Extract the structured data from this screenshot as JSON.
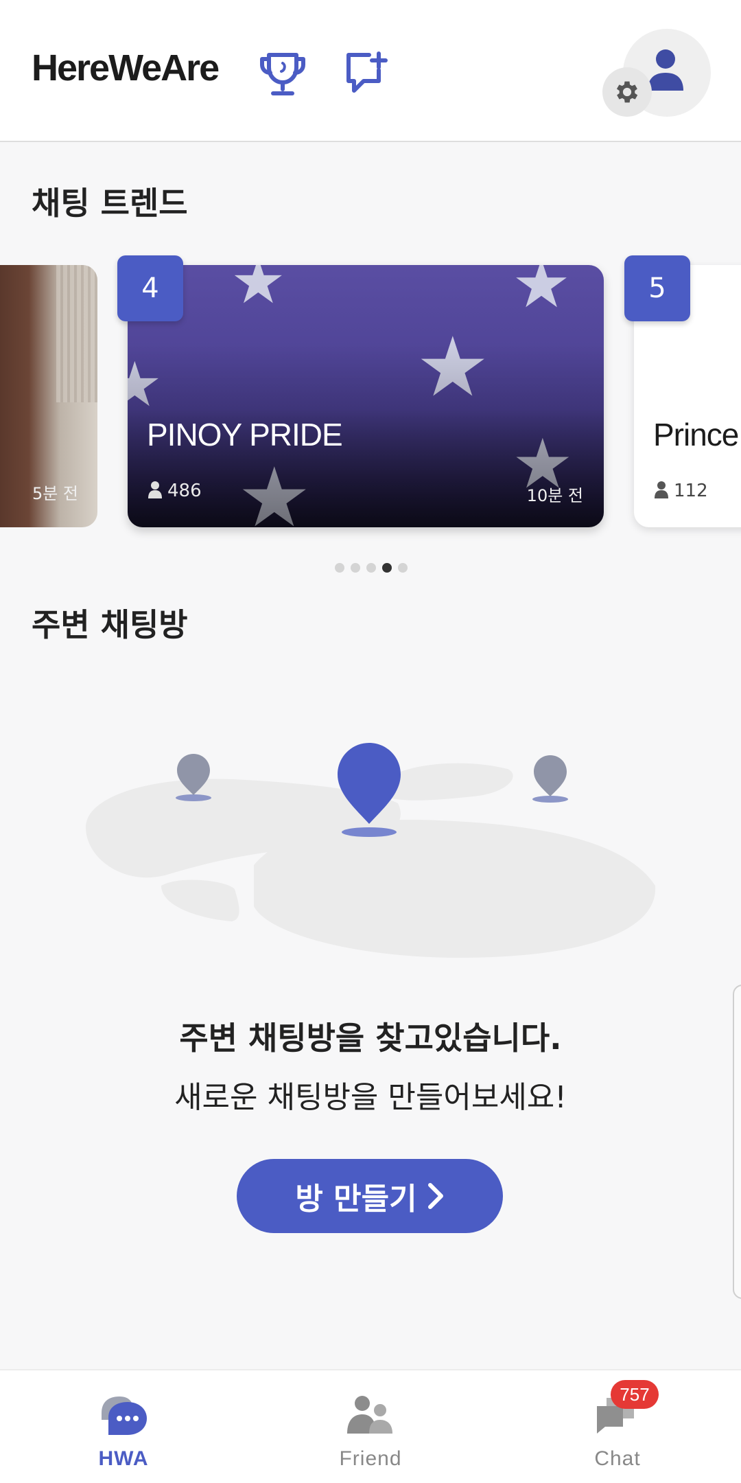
{
  "header": {
    "logo": "HereWeAre",
    "icons": [
      "trophy-icon",
      "new-chat-icon",
      "profile-icon",
      "settings-icon"
    ]
  },
  "trend": {
    "title": "채팅 트렌드",
    "cards": [
      {
        "rank": "",
        "title": "",
        "members": "",
        "time": "5분 전"
      },
      {
        "rank": "4",
        "title": "PINOY PRIDE",
        "members": "486",
        "time": "10분 전"
      },
      {
        "rank": "5",
        "title": "Prince",
        "members": "112",
        "time": ""
      }
    ],
    "pagination": {
      "total": 5,
      "active": 4
    }
  },
  "nearby": {
    "title": "주변 채팅방",
    "empty_title": "주변 채팅방을 찾고있습니다.",
    "empty_subtitle": "새로운 채팅방을 만들어보세요!",
    "create_button": "방 만들기"
  },
  "nav": {
    "items": [
      {
        "label": "HWA",
        "icon": "chat-bubble-icon",
        "active": true
      },
      {
        "label": "Friend",
        "icon": "friends-icon",
        "active": false
      },
      {
        "label": "Chat",
        "icon": "chats-icon",
        "active": false,
        "badge": "757"
      }
    ]
  },
  "colors": {
    "accent": "#4b5cc4",
    "badge": "#e53935",
    "background": "#f7f7f8"
  }
}
